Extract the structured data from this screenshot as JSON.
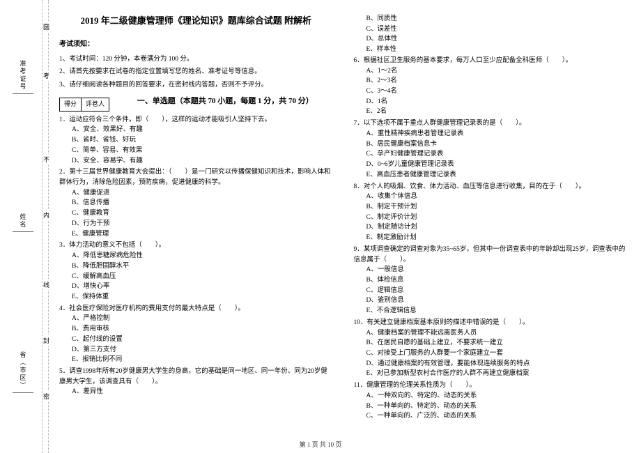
{
  "binding": {
    "labels": [
      "准考证号",
      "姓名",
      "省（市区）"
    ],
    "markers": [
      "考",
      "不",
      "内",
      "线",
      "封",
      "密"
    ],
    "top_mark": "圆"
  },
  "title": "2019 年二级健康管理师《理论知识》题库综合试题 附解析",
  "notice": {
    "heading": "考试须知：",
    "items": [
      "1、考试时间：120 分钟，本卷满分为 100 分。",
      "2、请首先按要求在试卷的指定位置填写您的姓名、准考证号等信息。",
      "3、请仔细阅读各种题目的回答要求，在密封线内答题，否则不予评分。"
    ]
  },
  "score_box": {
    "c1": "得分",
    "c2": "评卷人"
  },
  "section1": "一、单选题（本题共 70 小题，每题 1 分，共 70 分）",
  "q1": {
    "stem": "1．运动应符合三个条件，即（　　），这样的运动才能吸引人坚持下去。",
    "opts": [
      "A、安全、效果好、有趣",
      "B、省时、省钱、好玩",
      "C、简单、容易、有效果",
      "D、安全、容易学、有趣"
    ]
  },
  "q2": {
    "stem": "2．第十三届世界健康教育大会提出：（　　）是一门研究以传播保健知识和技术，影响人体和群体行为，消除危险因素，预防疾病，促进健康的科学。",
    "opts": [
      "A、健康促进",
      "B、信息传播",
      "C、健康教育",
      "D、行为干预",
      "E、健康管理"
    ]
  },
  "q3": {
    "stem": "3．体力活动的意义不包括（　　）。",
    "opts": [
      "A、降低患糖尿病危险性",
      "B、降低胆固醇水平",
      "C、缓解高血压",
      "D、增快心率",
      "E、保持体重"
    ]
  },
  "q4": {
    "stem": "4．社会医疗保险对医疗机构的费用支付的最大特点是（　　）。",
    "opts": [
      "A、严格控制",
      "B、费用审核",
      "C、起付线的设置",
      "D、第三方支付",
      "E、报销比例不同"
    ]
  },
  "q5": {
    "stem": "5．调查1998年所有20岁健康男大学生的身高，它的基础是同一地区、同一年份、同为20岁健康男大学生，该调查具有（　　）。",
    "opts_left": [
      "A、差异性"
    ],
    "opts_right": [
      "B、同质性",
      "C、误差性",
      "D、总体性",
      "E、样本性"
    ]
  },
  "q6": {
    "stem": "6．根据社区卫生服务的基本要求，每万人口至少应配备全科医师（　　）。",
    "opts": [
      "A、1～2名",
      "B、2～3名",
      "C、3～4名",
      "D、1名",
      "E、2名"
    ]
  },
  "q7": {
    "stem": "7．以下选项不属于重点人群健康管理记录表的是（　　）。",
    "opts": [
      "A、重性精神疾病患者管理记录表",
      "B、居民健康档案信息卡",
      "C、孕产妇健康管理记录表",
      "D、0~6岁儿童健康管理记录表",
      "E、高血压患者健康管理记录表"
    ]
  },
  "q8": {
    "stem": "8．对个人的吸烟、饮食、体力活动、血压等信息进行收集，目的在于（　　）。",
    "opts": [
      "A、收集个体信息",
      "B、制定干预计划",
      "C、制定评价计划",
      "D、制定随访计划",
      "E、制定激励计划"
    ]
  },
  "q9": {
    "stem": "9．某项调查确定的调查对象为35~65岁，但其中一份调查表中的年龄却出现25岁，调查表中的信息属于（　　）。",
    "opts": [
      "A、一般信息",
      "B、体检信息",
      "C、逻辑信息",
      "D、鉴别信息",
      "E、不合逻辑信息"
    ]
  },
  "q10": {
    "stem": "10．有关建立健康档案基本原则的描述中错误的是（　　）。",
    "opts": [
      "A、健康档案的管理不能远离医务人员",
      "B、在居民自愿的基础上建立，不要求统一建立",
      "C、对接受上门服务的人群要一个家庭建立一套",
      "D、通过健康档案的有效管理，要能体现连续服务的特点",
      "E、对已参加新型农村合作医疗的人群不再建立健康档案"
    ]
  },
  "q11": {
    "stem": "11．健康管理的伦理关系性质为（　　）。",
    "opts": [
      "A、一种双向的、特定的、动态的关系",
      "B、一种单向的、特定的、动态的关系",
      "C、一种单向的、广泛的、动态的关系"
    ]
  },
  "footer": "第 1 页 共 10 页"
}
